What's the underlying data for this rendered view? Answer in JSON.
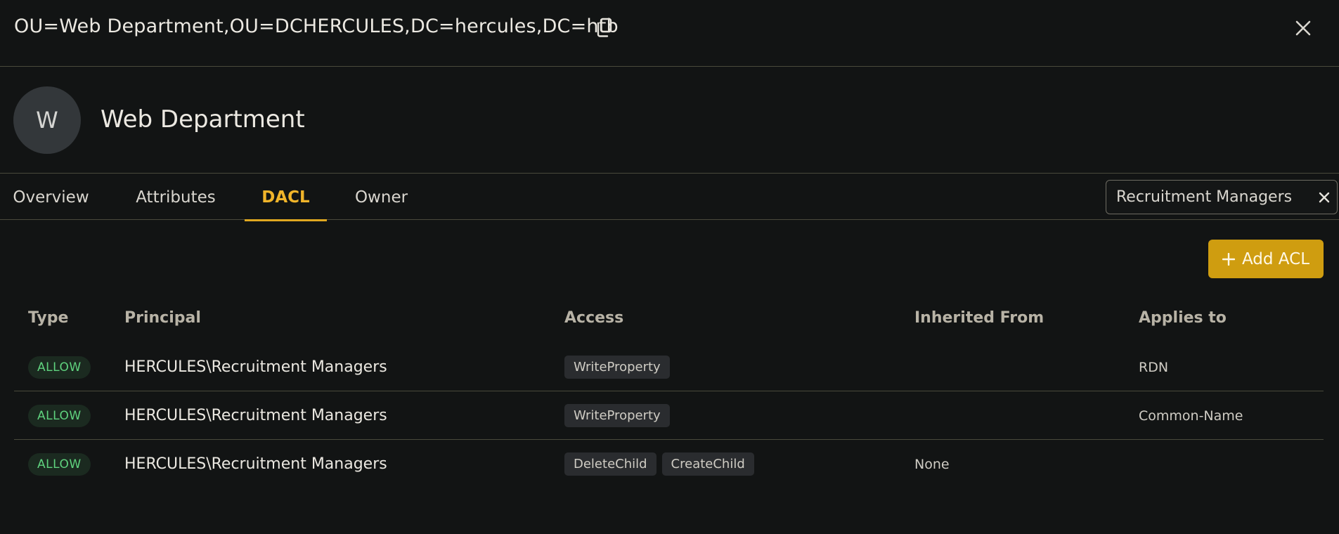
{
  "header": {
    "distinguished_name": "OU=Web Department,OU=DCHERCULES,DC=hercules,DC=htb",
    "copy_icon": "copy-icon",
    "close_icon": "close-icon"
  },
  "object": {
    "avatar_initial": "W",
    "name": "Web Department"
  },
  "tabs": [
    {
      "label": "Overview",
      "active": false
    },
    {
      "label": "Attributes",
      "active": false
    },
    {
      "label": "DACL",
      "active": true
    },
    {
      "label": "Owner",
      "active": false
    }
  ],
  "filter": {
    "value": "Recruitment Managers"
  },
  "actions": {
    "add_acl_label": "Add ACL"
  },
  "table": {
    "columns": [
      "Type",
      "Principal",
      "Access",
      "Inherited From",
      "Applies to"
    ],
    "rows": [
      {
        "type": "ALLOW",
        "principal": "HERCULES\\Recruitment Managers",
        "access": [
          "WriteProperty"
        ],
        "inherited_from": "",
        "applies_to": "RDN"
      },
      {
        "type": "ALLOW",
        "principal": "HERCULES\\Recruitment Managers",
        "access": [
          "WriteProperty"
        ],
        "inherited_from": "",
        "applies_to": "Common-Name"
      },
      {
        "type": "ALLOW",
        "principal": "HERCULES\\Recruitment Managers",
        "access": [
          "DeleteChild",
          "CreateChild"
        ],
        "inherited_from": "None",
        "applies_to": ""
      }
    ]
  },
  "colors": {
    "background": "#121414",
    "accent": "#cf9d10",
    "active_tab": "#f0b42a",
    "allow_text": "#5fd27e",
    "divider": "#4a4a3c"
  }
}
